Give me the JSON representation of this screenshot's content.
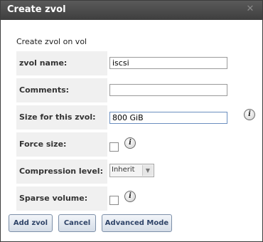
{
  "window": {
    "title": "Create zvol"
  },
  "form": {
    "intro": "Create zvol on vol",
    "fields": {
      "zvol_name": {
        "label": "zvol name:",
        "value": "iscsi"
      },
      "comments": {
        "label": "Comments:",
        "value": ""
      },
      "size": {
        "label": "Size for this zvol:",
        "value": "800 GiB"
      },
      "force_size": {
        "label": "Force size:",
        "checked": false
      },
      "compression": {
        "label": "Compression level:",
        "value": "Inherit"
      },
      "sparse": {
        "label": "Sparse volume:",
        "checked": false
      }
    }
  },
  "buttons": {
    "add_zvol": "Add zvol",
    "cancel": "Cancel",
    "advanced_mode": "Advanced Mode"
  },
  "icons": {
    "close": "close-icon",
    "info": "info-icon"
  }
}
